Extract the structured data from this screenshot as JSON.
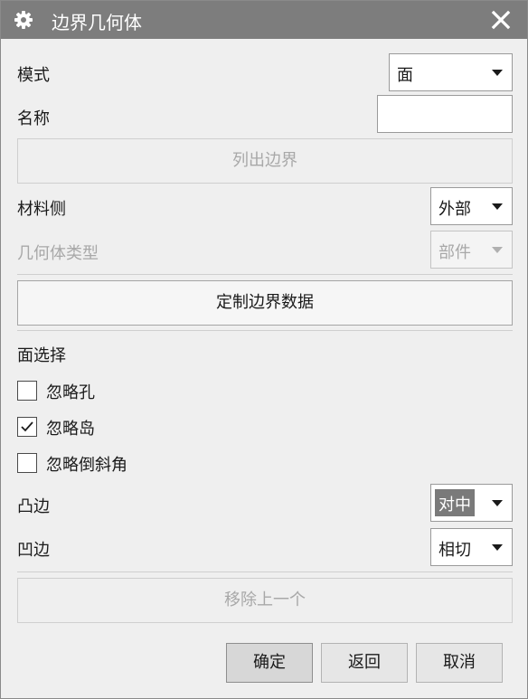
{
  "window": {
    "title": "边界几何体",
    "icon": "gear-icon",
    "close_icon": "close-icon"
  },
  "mode": {
    "label": "模式",
    "value": "面"
  },
  "name": {
    "label": "名称",
    "value": ""
  },
  "list_boundaries_button": "列出边界",
  "material_side": {
    "label": "材料侧",
    "value": "外部"
  },
  "geometry_type": {
    "label": "几何体类型",
    "value": "部件"
  },
  "custom_boundary_button": "定制边界数据",
  "face_selection": {
    "heading": "面选择",
    "options": [
      {
        "label": "忽略孔",
        "checked": false
      },
      {
        "label": "忽略岛",
        "checked": true
      },
      {
        "label": "忽略倒斜角",
        "checked": false
      }
    ]
  },
  "convex_edge": {
    "label": "凸边",
    "value": "对中"
  },
  "concave_edge": {
    "label": "凹边",
    "value": "相切"
  },
  "remove_previous_button": "移除上一个",
  "footer": {
    "ok": "确定",
    "back": "返回",
    "cancel": "取消"
  },
  "colors": {
    "title_bar": "#7d7d7d",
    "dialog_bg": "#efefef",
    "disabled_text": "#a8a8a8"
  }
}
